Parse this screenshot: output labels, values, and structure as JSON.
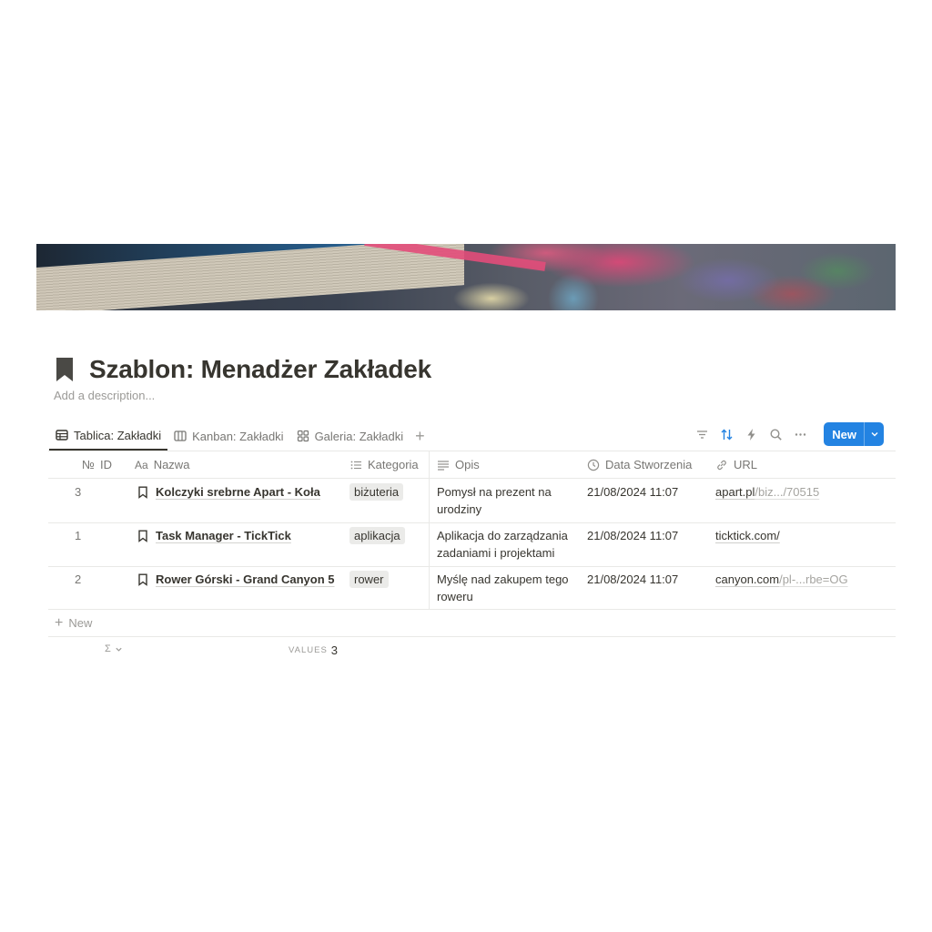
{
  "page": {
    "title": "Szablon: Menadżer Zakładek",
    "description_placeholder": "Add a description...",
    "icon": "bookmark-icon"
  },
  "tabs": [
    {
      "label": "Tablica: Zakładki",
      "icon": "table-icon",
      "active": true
    },
    {
      "label": "Kanban: Zakładki",
      "icon": "board-icon",
      "active": false
    },
    {
      "label": "Galeria: Zakładki",
      "icon": "gallery-icon",
      "active": false
    }
  ],
  "toolbar": {
    "icons": [
      "filter-icon",
      "sort-icon",
      "lightning-icon",
      "search-icon",
      "more-icon"
    ],
    "new_label": "New",
    "accent": "#2383e2"
  },
  "columns": {
    "id": "ID",
    "name": "Nazwa",
    "category": "Kategoria",
    "description": "Opis",
    "created": "Data Stworzenia",
    "url": "URL"
  },
  "rows": [
    {
      "id": "3",
      "name": "Kolczyki srebrne Apart - Koła",
      "category": "biżuteria",
      "desc_line1": "Pomysł na prezent na",
      "desc_line2": "urodziny",
      "created": "21/08/2024 11:07",
      "url_main": "apart.pl",
      "url_rest": "/biz.../70515"
    },
    {
      "id": "1",
      "name": "Task Manager - TickTick",
      "category": "aplikacja",
      "desc_line1": "Aplikacja do zarządzania",
      "desc_line2": "zadaniami i projektami",
      "created": "21/08/2024 11:07",
      "url_main": "ticktick.com/",
      "url_rest": ""
    },
    {
      "id": "2",
      "name": "Rower Górski - Grand Canyon 5",
      "category": "rower",
      "desc_line1": "Myślę nad zakupem tego",
      "desc_line2": "roweru",
      "created": "21/08/2024 11:07",
      "url_main": "canyon.com",
      "url_rest": "/pl-...rbe=OG"
    }
  ],
  "footer": {
    "new_row_label": "New",
    "calc_symbol": "Σ",
    "calc_label": "VALUES",
    "calc_value": "3"
  }
}
